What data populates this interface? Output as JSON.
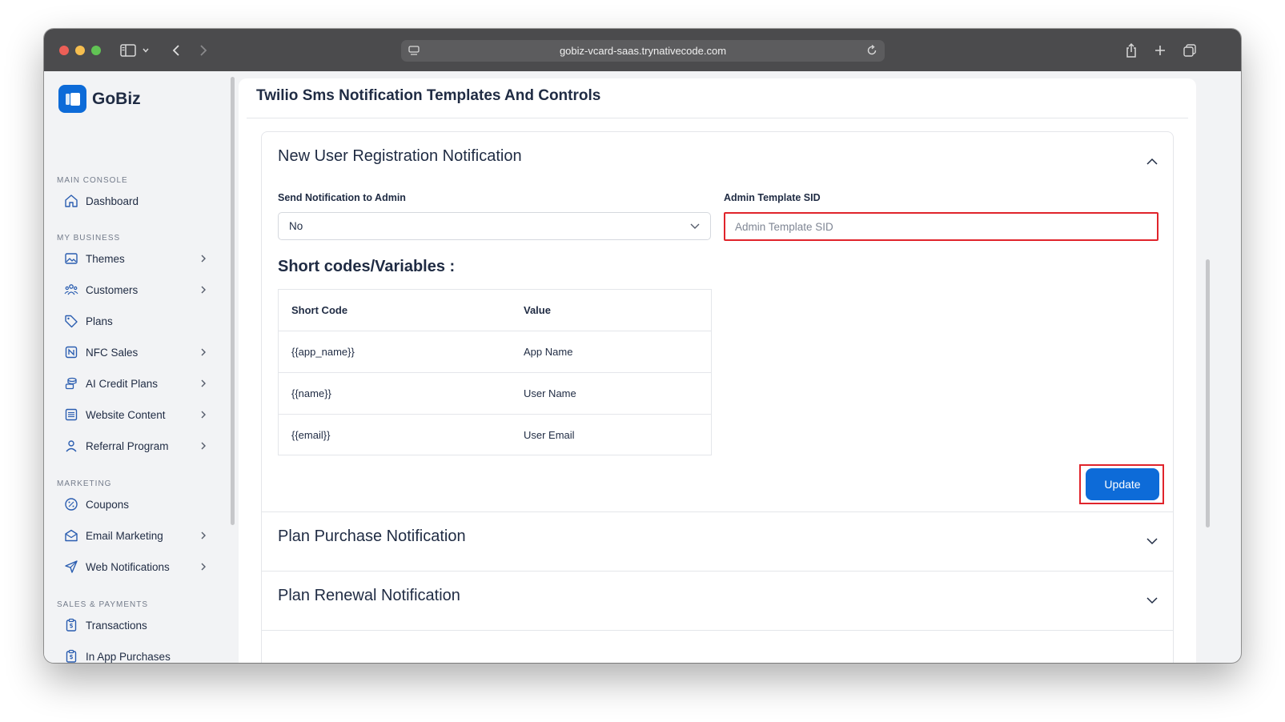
{
  "browser": {
    "url": "gobiz-vcard-saas.trynativecode.com",
    "traffic_light_colors": [
      "#ec5f57",
      "#f6be4f",
      "#61c354"
    ]
  },
  "brand": {
    "name": "GoBiz",
    "color": "#0d6bd8"
  },
  "sidebar": {
    "sections": [
      {
        "label": "MAIN CONSOLE",
        "items": [
          {
            "label": "Dashboard",
            "icon": "home-icon",
            "has_submenu": false
          }
        ]
      },
      {
        "label": "MY BUSINESS",
        "items": [
          {
            "label": "Themes",
            "icon": "image-icon",
            "has_submenu": true
          },
          {
            "label": "Customers",
            "icon": "users-icon",
            "has_submenu": true
          },
          {
            "label": "Plans",
            "icon": "tag-icon",
            "has_submenu": false
          },
          {
            "label": "NFC Sales",
            "icon": "nfc-icon",
            "has_submenu": true
          },
          {
            "label": "AI Credit Plans",
            "icon": "coins-icon",
            "has_submenu": true
          },
          {
            "label": "Website Content",
            "icon": "document-icon",
            "has_submenu": true
          },
          {
            "label": "Referral Program",
            "icon": "user-icon",
            "has_submenu": true
          }
        ]
      },
      {
        "label": "MARKETING",
        "items": [
          {
            "label": "Coupons",
            "icon": "percent-icon",
            "has_submenu": false
          },
          {
            "label": "Email Marketing",
            "icon": "mail-icon",
            "has_submenu": true
          },
          {
            "label": "Web Notifications",
            "icon": "send-icon",
            "has_submenu": true
          }
        ]
      },
      {
        "label": "SALES & PAYMENTS",
        "items": [
          {
            "label": "Transactions",
            "icon": "receipt-icon",
            "has_submenu": false
          },
          {
            "label": "In App Purchases",
            "icon": "receipt-icon",
            "has_submenu": false
          }
        ]
      }
    ]
  },
  "main": {
    "title": "Twilio Sms Notification Templates And Controls",
    "accordion": [
      {
        "title": "New User Registration Notification",
        "expanded": true,
        "send_label": "Send Notification to Admin",
        "send_value": "No",
        "sid_label": "Admin Template SID",
        "sid_placeholder": "Admin Template SID",
        "sid_value": "",
        "shortcodes_title": "Short codes/Variables :",
        "table": {
          "headers": [
            "Short Code",
            "Value"
          ],
          "rows": [
            [
              "{{app_name}}",
              "App Name"
            ],
            [
              "{{name}}",
              "User Name"
            ],
            [
              "{{email}}",
              "User Email"
            ]
          ]
        },
        "update_label": "Update"
      },
      {
        "title": "Plan Purchase Notification",
        "expanded": false
      },
      {
        "title": "Plan Renewal Notification",
        "expanded": false
      }
    ]
  }
}
